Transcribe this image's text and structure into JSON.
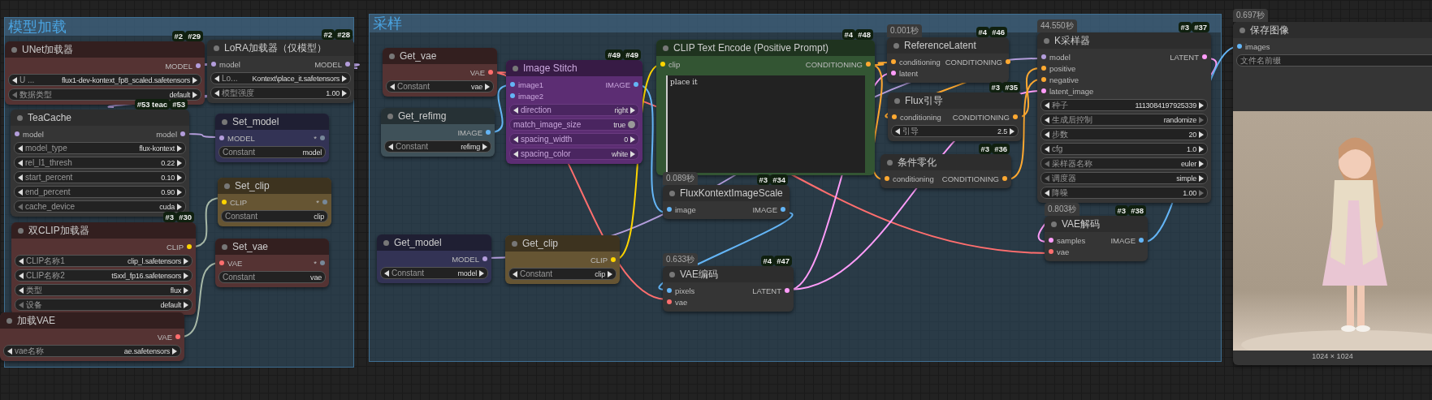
{
  "groups": [
    {
      "title": "模型加载",
      "nodes": [
        {
          "title": "UNet加载器",
          "color": "#553333",
          "muted": false,
          "badges": [
            "#2",
            "#29"
          ],
          "outputs": [
            {
              "name": "MODEL",
              "color": "#b39ddb"
            }
          ],
          "widgets": [
            {
              "kind": "combo",
              "label": "U ...",
              "value": "flux1-dev-kontext_fp8_scaled.safetensors"
            },
            {
              "kind": "combo",
              "label": "数据类型",
              "value": "default",
              "left_dim": true
            }
          ]
        },
        {
          "title": "LoRA加载器（仅模型）",
          "color": "#353535",
          "muted": false,
          "badges": [
            "#2",
            "#28"
          ],
          "inputs": [
            {
              "name": "model",
              "color": "#b39ddb"
            }
          ],
          "outputs": [
            {
              "name": "MODEL",
              "color": "#b39ddb"
            }
          ],
          "widgets": [
            {
              "kind": "combo",
              "label": "Lo...",
              "value": "Kontext\\place_it.safetensors"
            },
            {
              "kind": "combo",
              "label": "模型强度",
              "value": "1.00"
            }
          ]
        },
        {
          "title": "TeaCache",
          "color": "#353535",
          "muted": false,
          "badges": [
            "#53 teac",
            "#53"
          ],
          "inputs": [
            {
              "name": "model",
              "color": "#b39ddb"
            }
          ],
          "outputs": [
            {
              "name": "model",
              "color": "#b39ddb"
            }
          ],
          "widgets": [
            {
              "kind": "combo",
              "label": "model_type",
              "value": "flux-kontext"
            },
            {
              "kind": "combo",
              "label": "rel_l1_thresh",
              "value": "0.22"
            },
            {
              "kind": "combo",
              "label": "start_percent",
              "value": "0.10"
            },
            {
              "kind": "combo",
              "label": "end_percent",
              "value": "0.90"
            },
            {
              "kind": "combo",
              "label": "cache_device",
              "value": "cuda",
              "left_dim": true
            }
          ]
        },
        {
          "title": "Set_model",
          "color": "#333355",
          "muted": false,
          "inputs": [
            {
              "name": "MODEL",
              "color": "#b39ddb"
            }
          ],
          "outputs": [
            {
              "name": "*",
              "color": "#778899"
            }
          ],
          "widgets": [
            {
              "kind": "text",
              "label": "Constant",
              "value": "model"
            }
          ]
        },
        {
          "title": "Set_clip",
          "color": "#665533",
          "muted": false,
          "inputs": [
            {
              "name": "CLIP",
              "color": "#ffd500"
            }
          ],
          "outputs": [
            {
              "name": "*",
              "color": "#778899"
            }
          ],
          "widgets": [
            {
              "kind": "text",
              "label": "Constant",
              "value": "clip"
            }
          ]
        },
        {
          "title": "双CLIP加载器",
          "color": "#553333",
          "muted": false,
          "badges": [
            "#3",
            "#30"
          ],
          "outputs": [
            {
              "name": "CLIP",
              "color": "#ffd500"
            }
          ],
          "widgets": [
            {
              "kind": "combo",
              "label": "CLIP名称1",
              "value": "clip_l.safetensors"
            },
            {
              "kind": "combo",
              "label": "CLIP名称2",
              "value": "t5xxl_fp16.safetensors"
            },
            {
              "kind": "combo",
              "label": "类型",
              "value": "flux"
            },
            {
              "kind": "combo",
              "label": "设备",
              "value": "default",
              "left_dim": true
            }
          ]
        },
        {
          "title": "Set_vae",
          "color": "#553333",
          "muted": false,
          "inputs": [
            {
              "name": "VAE",
              "color": "#ff6e6e"
            }
          ],
          "outputs": [
            {
              "name": "*",
              "color": "#778899"
            }
          ],
          "widgets": [
            {
              "kind": "text",
              "label": "Constant",
              "value": "vae"
            }
          ]
        },
        {
          "title": "加载VAE",
          "color": "#553333",
          "muted": false,
          "outputs": [
            {
              "name": "VAE",
              "color": "#ff6e6e"
            }
          ],
          "widgets": [
            {
              "kind": "combo",
              "label": "vae名称",
              "value": "ae.safetensors"
            }
          ]
        }
      ]
    },
    {
      "title": "采样",
      "nodes": [
        {
          "title": "Get_vae",
          "color": "#553333",
          "muted": false,
          "outputs": [
            {
              "name": "VAE",
              "color": "#ff6e6e"
            }
          ],
          "widgets": [
            {
              "kind": "combo",
              "label": "Constant",
              "value": "vae"
            }
          ]
        },
        {
          "title": "Image Stitch",
          "color": "#5c2d73",
          "muted": true,
          "badges": [
            "#49",
            "#49"
          ],
          "inputs": [
            {
              "name": "image1",
              "color": "#64b5f6"
            },
            {
              "name": "image2",
              "color": "#64b5f6"
            }
          ],
          "outputs": [
            {
              "name": "IMAGE",
              "color": "#64b5f6"
            }
          ],
          "widgets": [
            {
              "kind": "combo",
              "label": "direction",
              "value": "right"
            },
            {
              "kind": "toggle",
              "label": "match_image_size",
              "value": "true",
              "on": true
            },
            {
              "kind": "combo",
              "label": "spacing_width",
              "value": "0"
            },
            {
              "kind": "combo",
              "label": "spacing_color",
              "value": "white"
            }
          ]
        },
        {
          "title": "Get_refimg",
          "color": "#3f5159",
          "muted": false,
          "outputs": [
            {
              "name": "IMAGE",
              "color": "#64b5f6"
            }
          ],
          "widgets": [
            {
              "kind": "combo",
              "label": "Constant",
              "value": "refimg"
            }
          ]
        },
        {
          "title": "CLIP Text Encode (Positive Prompt)",
          "color": "#335533",
          "muted": false,
          "badges": [
            "#4",
            "#48"
          ],
          "inputs": [
            {
              "name": "clip",
              "color": "#ffd500"
            }
          ],
          "outputs": [
            {
              "name": "CONDITIONING",
              "color": "#ffa931"
            }
          ],
          "widgets": [
            {
              "kind": "textarea",
              "value": "place it"
            }
          ]
        },
        {
          "title": "ReferenceLatent",
          "color": "#353535",
          "muted": false,
          "time": "0.001秒",
          "badges": [
            "#4",
            "#46"
          ],
          "inputs": [
            {
              "name": "conditioning",
              "color": "#ffa931"
            },
            {
              "name": "latent",
              "color": "#ff9cf9"
            }
          ],
          "outputs": [
            {
              "name": "CONDITIONING",
              "color": "#ffa931"
            }
          ]
        },
        {
          "title": "Flux引导",
          "color": "#353535",
          "muted": false,
          "badges": [
            "#3",
            "#35"
          ],
          "inputs": [
            {
              "name": "conditioning",
              "color": "#ffa931"
            }
          ],
          "outputs": [
            {
              "name": "CONDITIONING",
              "color": "#ffa931"
            }
          ],
          "widgets": [
            {
              "kind": "combo",
              "label": "引导",
              "value": "2.5"
            }
          ]
        },
        {
          "title": "K采样器",
          "color": "#353535",
          "muted": false,
          "time": "44.550秒",
          "badges": [
            "#3",
            "#37"
          ],
          "inputs": [
            {
              "name": "model",
              "color": "#b39ddb"
            },
            {
              "name": "positive",
              "color": "#ffa931"
            },
            {
              "name": "negative",
              "color": "#ffa931"
            },
            {
              "name": "latent_image",
              "color": "#ff9cf9"
            }
          ],
          "outputs": [
            {
              "name": "LATENT",
              "color": "#ff9cf9"
            }
          ],
          "widgets": [
            {
              "kind": "combo",
              "label": "种子",
              "value": "1113084197925339"
            },
            {
              "kind": "combo",
              "label": "生成后控制",
              "value": "randomize",
              "right_dim": true
            },
            {
              "kind": "combo",
              "label": "步数",
              "value": "20"
            },
            {
              "kind": "combo",
              "label": "cfg",
              "value": "1.0"
            },
            {
              "kind": "combo",
              "label": "采样器名称",
              "value": "euler",
              "left_dim": true
            },
            {
              "kind": "combo",
              "label": "调度器",
              "value": "simple",
              "left_dim": true
            },
            {
              "kind": "combo",
              "label": "降噪",
              "value": "1.00",
              "right_dim": true
            }
          ]
        },
        {
          "title": "FluxKontextImageScale",
          "color": "#353535",
          "muted": false,
          "time": "0.089秒",
          "badges": [
            "#3",
            "#34"
          ],
          "inputs": [
            {
              "name": "image",
              "color": "#64b5f6"
            }
          ],
          "outputs": [
            {
              "name": "IMAGE",
              "color": "#64b5f6"
            }
          ]
        },
        {
          "title": "条件零化",
          "color": "#353535",
          "muted": false,
          "badges": [
            "#3",
            "#36"
          ],
          "inputs": [
            {
              "name": "conditioning",
              "color": "#ffa931"
            }
          ],
          "outputs": [
            {
              "name": "CONDITIONING",
              "color": "#ffa931"
            }
          ]
        },
        {
          "title": "VAE解码",
          "color": "#353535",
          "muted": false,
          "time": "0.803秒",
          "badges": [
            "#3",
            "#38"
          ],
          "inputs": [
            {
              "name": "samples",
              "color": "#ff9cf9"
            },
            {
              "name": "vae",
              "color": "#ff6e6e"
            }
          ],
          "outputs": [
            {
              "name": "IMAGE",
              "color": "#64b5f6"
            }
          ]
        },
        {
          "title": "Get_model",
          "color": "#333355",
          "muted": false,
          "outputs": [
            {
              "name": "MODEL",
              "color": "#b39ddb"
            }
          ],
          "widgets": [
            {
              "kind": "combo",
              "label": "Constant",
              "value": "model"
            }
          ]
        },
        {
          "title": "Get_clip",
          "color": "#665533",
          "muted": false,
          "outputs": [
            {
              "name": "CLIP",
              "color": "#ffd500"
            }
          ],
          "widgets": [
            {
              "kind": "combo",
              "label": "Constant",
              "value": "clip"
            }
          ]
        },
        {
          "title": "VAE编码",
          "color": "#353535",
          "muted": false,
          "time": "0.633秒",
          "badges": [
            "#4",
            "#47"
          ],
          "inputs": [
            {
              "name": "pixels",
              "color": "#64b5f6"
            },
            {
              "name": "vae",
              "color": "#ff6e6e"
            }
          ],
          "outputs": [
            {
              "name": "LATENT",
              "color": "#ff9cf9"
            }
          ]
        }
      ]
    }
  ],
  "nodes": [
    {
      "title": "保存图像",
      "color": "#353535",
      "muted": false,
      "time": "0.697秒",
      "inputs": [
        {
          "name": "images",
          "color": "#64b5f6"
        }
      ],
      "widgets": [
        {
          "kind": "text",
          "label": "文件名前缀"
        }
      ],
      "preview": {
        "kind": "picture",
        "size": "1024 × 1024"
      }
    }
  ]
}
